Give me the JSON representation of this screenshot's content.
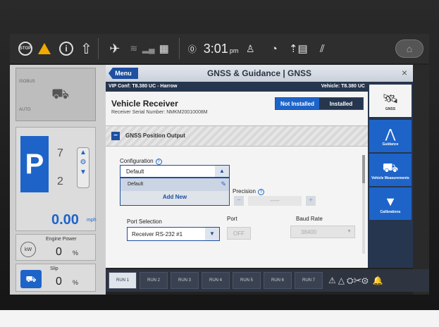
{
  "status_bar": {
    "stop_label": "STOP",
    "clock": "3:01",
    "clock_suffix": "pm",
    "icons": [
      "stop-icon",
      "warning-icon",
      "info-icon",
      "up-arrow-icon",
      "satellite-alert-icon",
      "wifi-icon",
      "signal-icon",
      "grid-icon",
      "help-icon",
      "user-icon",
      "gauge-icon",
      "status-icon",
      "field-icon",
      "home-icon"
    ]
  },
  "left_panel": {
    "isobus_label": "ISOBUS",
    "auto_label": "AUTO",
    "gear_letter": "P",
    "gear_upper": "7",
    "gear_lower": "2",
    "speed_value": "0.00",
    "speed_unit": "mph",
    "engine_power_label": "Engine Power",
    "engine_kw_label": "kW",
    "engine_power_value": "0",
    "engine_power_unit": "%",
    "slip_label": "Slip",
    "slip_value": "0",
    "slip_unit": "%"
  },
  "dialog": {
    "menu_label": "Menu",
    "title": "GNSS & Guidance | GNSS",
    "close_glyph": "×",
    "vip_conf": "VIP Conf: T8.380 UC - Harrow",
    "vehicle": "Vehicle: T8.380 UC",
    "receiver_title": "Vehicle Receiver",
    "serial_text": "Receiver Serial Number: NMKM20010008M",
    "install_options": [
      "Not Installed",
      "Installed"
    ],
    "install_selected": "Not Installed",
    "section_title": "GNSS Position Output",
    "configuration_label": "Configuration",
    "configuration_value": "Default",
    "dropdown_options": [
      "Default"
    ],
    "add_new_label": "Add New",
    "precision_label": "Precision",
    "precision_value": "-----",
    "port_selection_label": "Port Selection",
    "port_selection_value": "Receiver RS-232 #1",
    "port_label": "Port",
    "port_value": "OFF",
    "baud_label": "Baud Rate",
    "baud_value": "38400"
  },
  "right_column": [
    {
      "label": "GNSS",
      "icon": "satellite-icon"
    },
    {
      "label": "Guidance",
      "icon": "guidance-icon"
    },
    {
      "label": "Vehicle Measurements",
      "icon": "vehicle-icon"
    },
    {
      "label": "Calibrations",
      "icon": "calibration-icon"
    }
  ],
  "run_bar": {
    "tabs": [
      "RUN 1",
      "RUN 2",
      "RUN 3",
      "RUN 4",
      "RUN 5",
      "RUN 6",
      "RUN 7"
    ],
    "active_tab": "RUN 1"
  },
  "colors": {
    "accent": "#1e64c8",
    "header_dark": "#26364e",
    "warning": "#f2a900"
  }
}
